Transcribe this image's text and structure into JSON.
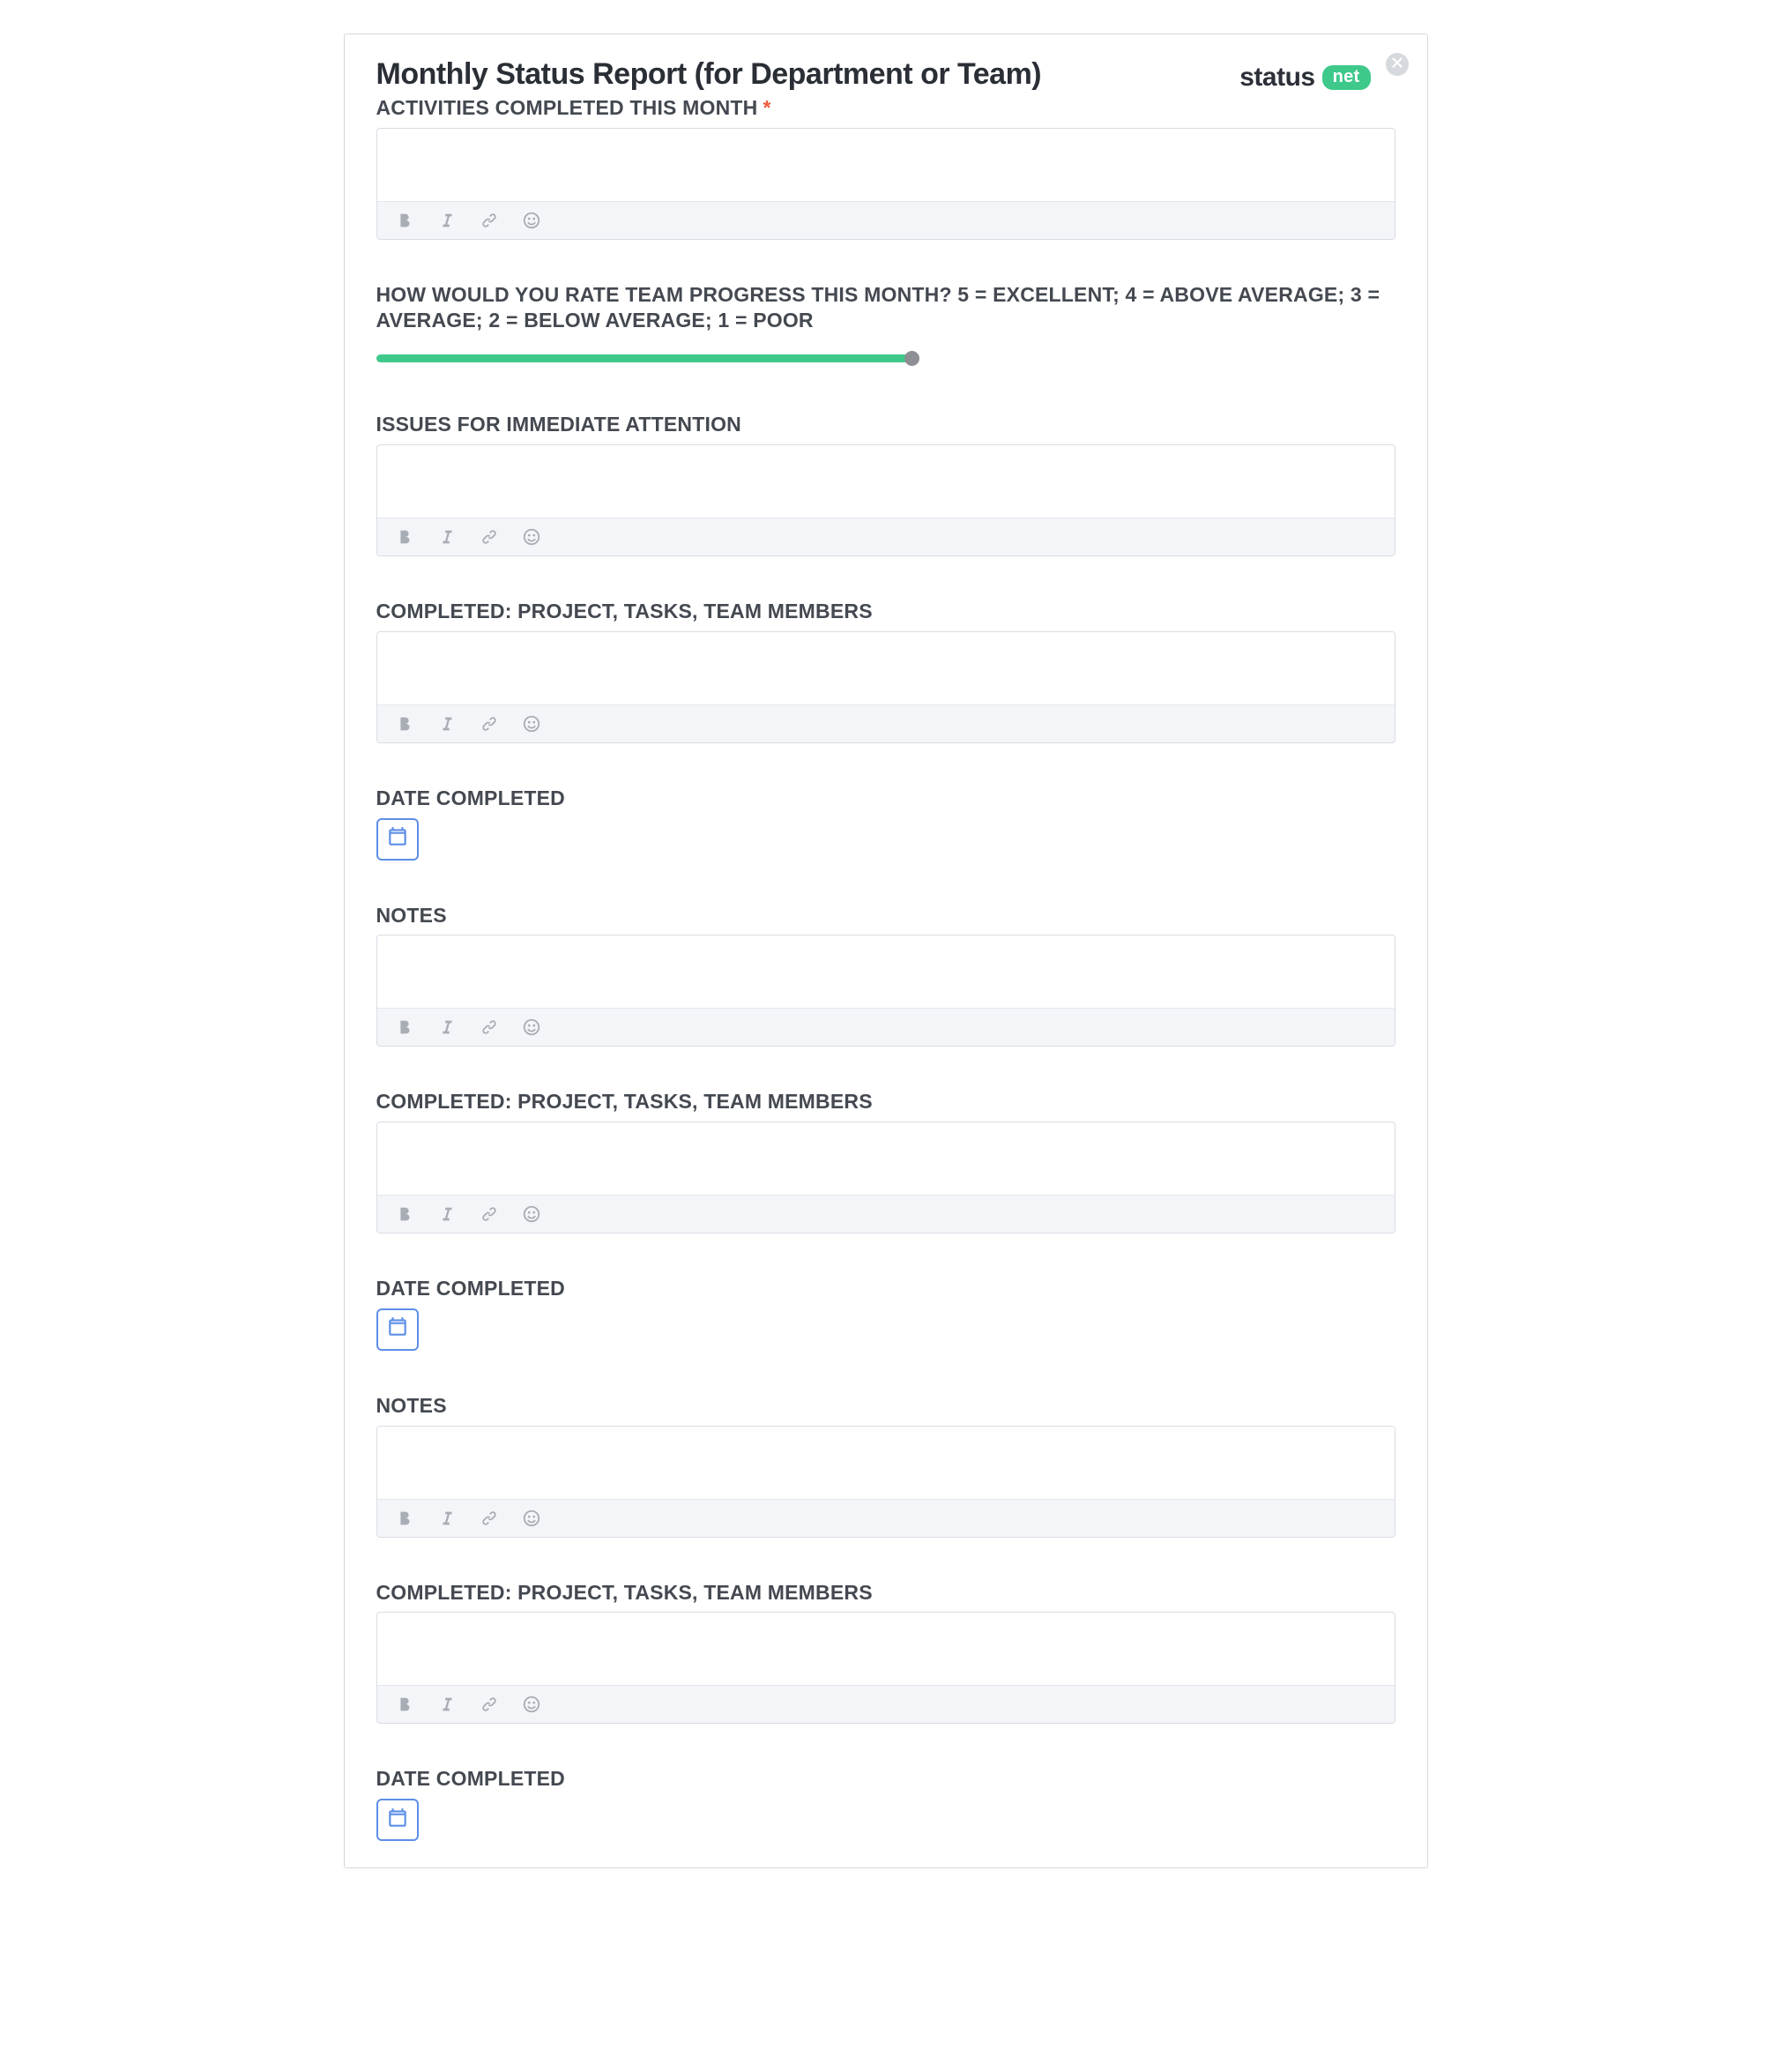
{
  "header": {
    "title": "Monthly Status Report (for Department or Team)",
    "brand_word": "status",
    "brand_pill": "net"
  },
  "toolbar_icons": {
    "bold": "bold-icon",
    "italic": "italic-icon",
    "link": "link-icon",
    "emoji": "emoji-icon"
  },
  "fields": [
    {
      "id": "activities",
      "type": "richtext",
      "label": "ACTIVITIES COMPLETED THIS MONTH",
      "required": true
    },
    {
      "id": "rating",
      "type": "slider",
      "label": "HOW WOULD YOU RATE TEAM PROGRESS THIS MONTH? 5 = EXCELLENT; 4 = ABOVE AVERAGE; 3 = AVERAGE; 2 = BELOW AVERAGE; 1 = POOR",
      "min": 1,
      "max": 5,
      "value": 5
    },
    {
      "id": "issues",
      "type": "richtext",
      "label": "ISSUES FOR IMMEDIATE ATTENTION"
    },
    {
      "id": "completed_1",
      "type": "richtext",
      "label": "COMPLETED: PROJECT, TASKS, TEAM MEMBERS"
    },
    {
      "id": "date_1",
      "type": "date",
      "label": "DATE COMPLETED"
    },
    {
      "id": "notes_1",
      "type": "richtext",
      "label": "NOTES"
    },
    {
      "id": "completed_2",
      "type": "richtext",
      "label": "COMPLETED: PROJECT, TASKS, TEAM MEMBERS"
    },
    {
      "id": "date_2",
      "type": "date",
      "label": "DATE COMPLETED"
    },
    {
      "id": "notes_2",
      "type": "richtext",
      "label": "NOTES"
    },
    {
      "id": "completed_3",
      "type": "richtext",
      "label": "COMPLETED: PROJECT, TASKS, TEAM MEMBERS"
    },
    {
      "id": "date_3",
      "type": "date",
      "label": "DATE COMPLETED"
    }
  ]
}
